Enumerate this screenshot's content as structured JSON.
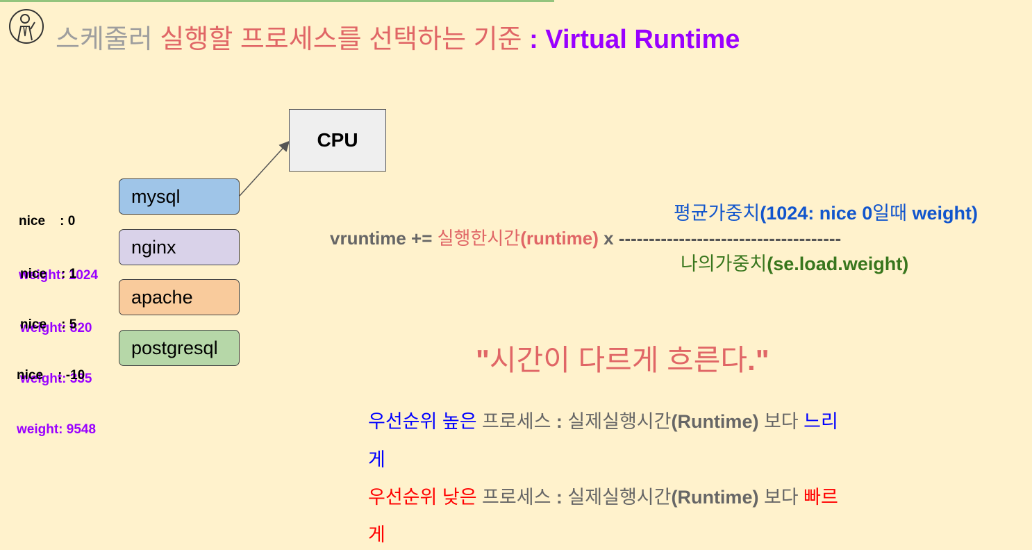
{
  "title": {
    "part1": "스케줄러 ",
    "part2": "실행할 프로세스를 선택하는 기준",
    "part3": " : Virtual Runtime"
  },
  "cpu_label": "CPU",
  "processes": [
    {
      "name": "mysql",
      "nice": "nice    : 0",
      "weight": "weight: 1024",
      "color": "#9fc5e8"
    },
    {
      "name": "nginx",
      "nice": "nice    : 1",
      "weight": "weight: 820",
      "color": "#d9d2e9"
    },
    {
      "name": "apache",
      "nice": "nice    : 5",
      "weight": "weight: 335",
      "color": "#f9cb9c"
    },
    {
      "name": "postgresql",
      "nice": "nice    : -10",
      "weight": "weight: 9548",
      "color": "#b6d7a8"
    }
  ],
  "formula": {
    "lhs": "vruntime += ",
    "runtime_ko": "실행한시간",
    "runtime_en": "(runtime)",
    "times": " x ",
    "dashes": "-------------------------------------",
    "numerator_ko": "평균가중치",
    "numerator_paren": "(1024: nice 0",
    "numerator_ko2": "일때",
    "numerator_end": " weight)",
    "denominator_ko": "나의가중치",
    "denominator_en": "(se.load.weight)"
  },
  "quote": {
    "open": "\"",
    "text": "시간이 다르게 흐른다",
    "close": ".\""
  },
  "notes": {
    "high": {
      "label": "우선순위 높은",
      "middle": " 프로세스 ",
      "colon": ": ",
      "real": "실제실행시간",
      "runtime": "(Runtime)",
      "than": " 보다 ",
      "adv1": "느리",
      "adv2": "게"
    },
    "low": {
      "label": "우선순위 낮은",
      "middle": " 프로세스 ",
      "colon": ": ",
      "real": "실제실행시간",
      "runtime": "(Runtime)",
      "than": " 보다 ",
      "adv1": "빠르",
      "adv2": "게"
    }
  }
}
